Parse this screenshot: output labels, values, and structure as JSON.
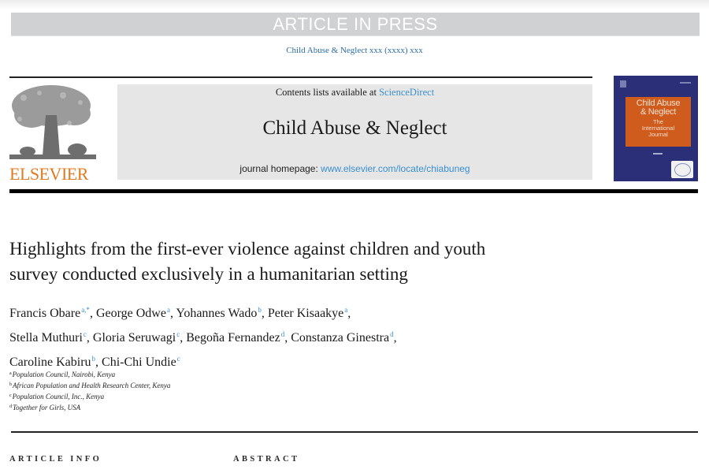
{
  "banner": {
    "label": "ARTICLE IN PRESS"
  },
  "citation": "Child Abuse & Neglect xxx (xxxx) xxx",
  "publisher": {
    "name": "ELSEVIER",
    "brand_color": "#e07a20"
  },
  "journal_box": {
    "contents_prefix": "Contents lists available at ",
    "contents_link": "ScienceDirect",
    "title": "Child Abuse & Neglect",
    "homepage_prefix": "journal homepage: ",
    "homepage_link": "www.elsevier.com/locate/chiabuneg",
    "link_color": "#3a8fd0"
  },
  "cover": {
    "title_line1": "Child Abuse",
    "title_line2": "& Neglect",
    "subtitle_line1": "The",
    "subtitle_line2": "International",
    "subtitle_line3": "Journal"
  },
  "article": {
    "title_line1": "Highlights from the first-ever violence against children and youth",
    "title_line2": "survey conducted exclusively in a humanitarian setting",
    "authors": [
      {
        "name": "Francis Obare",
        "aff": "a,*",
        "sep": ", "
      },
      {
        "name": "George Odwe",
        "aff": "a",
        "sep": ", "
      },
      {
        "name": "Yohannes Wado",
        "aff": "b",
        "sep": ", "
      },
      {
        "name": "Peter Kisaakye",
        "aff": "a",
        "sep": ","
      },
      {
        "name": "Stella Muthuri",
        "aff": "c",
        "sep": ", "
      },
      {
        "name": "Gloria Seruwagi",
        "aff": "c",
        "sep": ", "
      },
      {
        "name": "Begoña Fernandez",
        "aff": "d",
        "sep": ", "
      },
      {
        "name": "Constanza Ginestra",
        "aff": "d",
        "sep": ","
      },
      {
        "name": "Caroline Kabiru",
        "aff": "b",
        "sep": ", "
      },
      {
        "name": "Chi-Chi Undie",
        "aff": "c",
        "sep": ""
      }
    ],
    "affiliations": [
      {
        "key": "a",
        "text": "Population Council, Nairobi, Kenya"
      },
      {
        "key": "b",
        "text": "African Population and Health Research Center, Kenya"
      },
      {
        "key": "c",
        "text": "Population Council, Inc., Kenya"
      },
      {
        "key": "d",
        "text": "Together for Girls, USA"
      }
    ]
  },
  "sections": {
    "article_info": "ARTICLE INFO",
    "abstract": "ABSTRACT"
  }
}
